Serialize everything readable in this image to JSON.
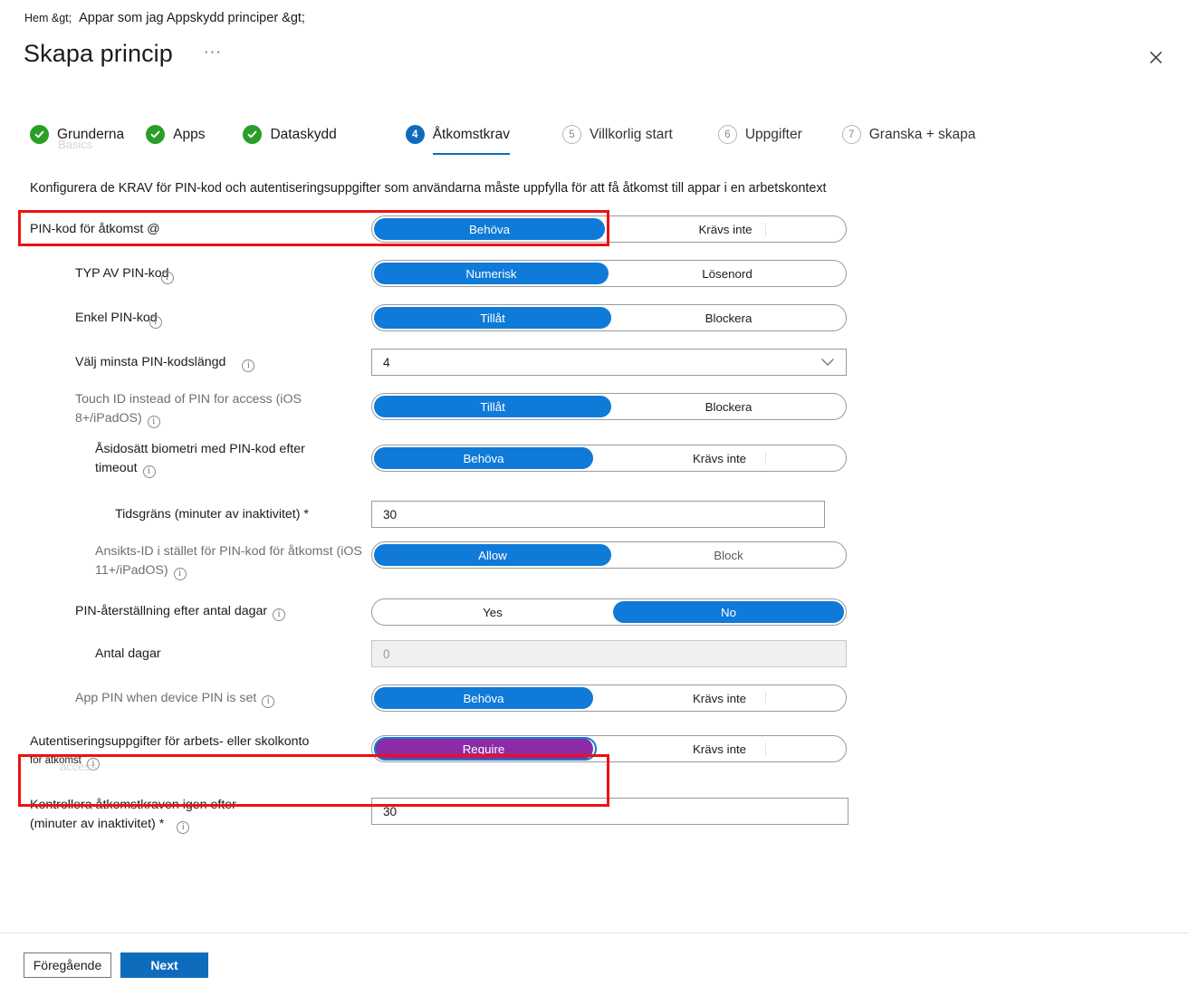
{
  "breadcrumb": {
    "crumb1": "Hem &gt;",
    "crumb2": "Appar som jag Appskydd principer &gt;"
  },
  "header": {
    "title": "Skapa princip",
    "ellipsis": "···",
    "close_icon": "close-icon"
  },
  "steps": [
    {
      "num": "1",
      "label": "Grunderna",
      "state": "done",
      "ghost": "Basics"
    },
    {
      "num": "2",
      "label": "Apps",
      "state": "done",
      "ghost": ""
    },
    {
      "num": "3",
      "label": "Dataskydd",
      "state": "done",
      "ghost": ""
    },
    {
      "num": "4",
      "label": "Åtkomstkrav",
      "state": "active",
      "ghost": ""
    },
    {
      "num": "5",
      "label": "Villkorlig start",
      "state": "todo",
      "ghost": ""
    },
    {
      "num": "6",
      "label": "Uppgifter",
      "state": "todo",
      "ghost": ""
    },
    {
      "num": "7",
      "label": "Granska + skapa",
      "state": "todo",
      "ghost": ""
    }
  ],
  "description": "Konfigurera de KRAV för PIN-kod och autentiseringsuppgifter som användarna måste uppfylla för att få åtkomst till appar i en arbetskontext",
  "rows": [
    {
      "label": "PIN-kod för åtkomst @",
      "type": "toggle",
      "left": "Behöva",
      "right": "Krävs inte",
      "selected": "left"
    },
    {
      "label": "TYP AV PIN-kod",
      "type": "toggle",
      "left": "Numerisk",
      "right": "Lösenord",
      "selected": "left"
    },
    {
      "label": "Enkel PIN-kod",
      "type": "toggle",
      "left": "Tillåt",
      "right": "Blockera",
      "selected": "left"
    },
    {
      "label": "Välj minsta PIN-kodslängd",
      "type": "dropdown",
      "value": "4"
    },
    {
      "label_line1": "Touch ID instead of PIN for access (iOS",
      "label_line2": "8+/iPadOS)",
      "type": "toggle",
      "left": "Tillåt",
      "right": "Blockera",
      "selected": "left"
    },
    {
      "label_line1": "Åsidosätt biometri med PIN-kod efter",
      "label_line2": "timeout",
      "type": "toggle",
      "left": "Behöva",
      "right": "Krävs inte",
      "selected": "left"
    },
    {
      "label": "Tidsgräns (minuter av inaktivitet) *",
      "type": "textbox",
      "value": "30"
    },
    {
      "label_line1": "Ansikts-ID i stället för PIN-kod för åtkomst (iOS",
      "label_line2": "11+/iPadOS)",
      "type": "toggle",
      "left": "Allow",
      "right": "Block",
      "selected": "left"
    },
    {
      "label": "PIN-återställning efter antal dagar",
      "type": "toggle",
      "left": "Yes",
      "right": "No",
      "selected": "right"
    },
    {
      "label": "Antal dagar",
      "type": "textbox-disabled",
      "value": "0"
    },
    {
      "label": "App PIN when device PIN is set",
      "type": "toggle",
      "left": "Behöva",
      "right": "Krävs inte",
      "selected": "left"
    },
    {
      "label_line1": "Autentiseringsuppgifter för arbets- eller skolkonto",
      "label_line2": "för åtkomst",
      "label_ghost": "access",
      "type": "toggle",
      "left": "Require",
      "right": "Krävs inte",
      "selected": "left"
    },
    {
      "label_line1": "Kontrollera åtkomstkraven igen efter",
      "label_line2": "(minuter av inaktivitet) *",
      "type": "textbox",
      "value": "30"
    }
  ],
  "footer": {
    "previous": "Föregående",
    "next": "Next"
  },
  "colors": {
    "accent": "#0f6cbd",
    "toggle_on": "#0f7ad8",
    "toggle_focus_purple": "#8d2aa6",
    "done_green": "#2a9e27",
    "highlight_red": "#ee1111"
  }
}
